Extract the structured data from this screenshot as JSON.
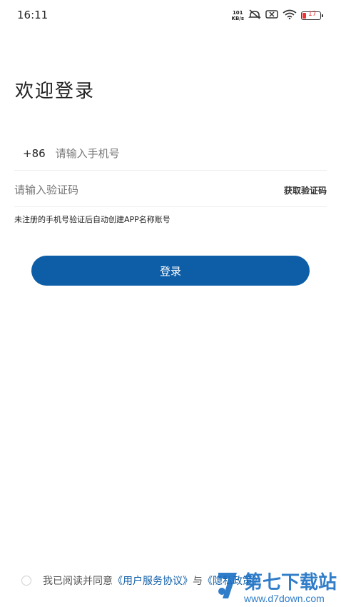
{
  "status_bar": {
    "time": "16:11",
    "net_speed_value": "101",
    "net_speed_unit": "KB/s",
    "battery_level": "17",
    "icons": [
      "mute-icon",
      "sim-off-icon",
      "wifi-icon",
      "battery-icon"
    ]
  },
  "login": {
    "title": "欢迎登录",
    "country_code": "+86",
    "phone_placeholder": "请输入手机号",
    "code_placeholder": "请输入验证码",
    "get_code_label": "获取验证码",
    "hint": "未注册的手机号验证后自动创建APP名称账号",
    "login_button_label": "登录"
  },
  "agreement": {
    "prefix": "我已阅读并同意",
    "user_agreement": "《用户服务协议》",
    "connector": "与",
    "privacy_policy": "《隐私政策》"
  },
  "watermark": {
    "name": "第七下载站",
    "url": "www.d7down.com"
  },
  "colors": {
    "primary": "#0d5da7",
    "battery_low": "#ee3333"
  }
}
